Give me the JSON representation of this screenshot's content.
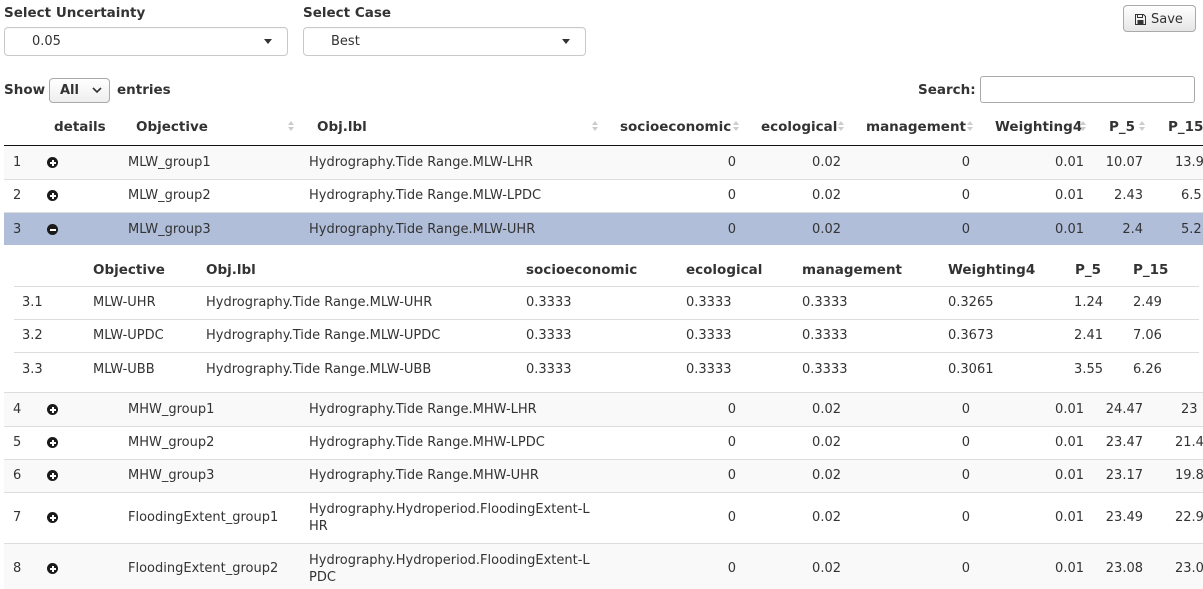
{
  "controls": {
    "uncertainty_label": "Select Uncertainty",
    "uncertainty_value": "0.05",
    "case_label": "Select Case",
    "case_value": "Best",
    "save_label": "Save",
    "show_label": "Show",
    "show_value": "All",
    "entries_label": "entries",
    "search_label": "Search:",
    "search_value": ""
  },
  "table": {
    "headers": [
      "details",
      "Objective",
      "Obj.lbl",
      "socioeconomic",
      "ecological",
      "management",
      "Weighting4",
      "P_5",
      "P_15"
    ],
    "rows": [
      {
        "idx": "1",
        "objective": "MLW_group1",
        "lbl": "Hydrography.Tide Range.MLW-LHR",
        "socio": "0",
        "eco": "0.02",
        "mgmt": "0",
        "w4": "0.01",
        "p5": "10.07",
        "p15": "13.9"
      },
      {
        "idx": "2",
        "objective": "MLW_group2",
        "lbl": "Hydrography.Tide Range.MLW-LPDC",
        "socio": "0",
        "eco": "0.02",
        "mgmt": "0",
        "w4": "0.01",
        "p5": "2.43",
        "p15": "6.5"
      },
      {
        "idx": "3",
        "objective": "MLW_group3",
        "lbl": "Hydrography.Tide Range.MLW-UHR",
        "socio": "0",
        "eco": "0.02",
        "mgmt": "0",
        "w4": "0.01",
        "p5": "2.4",
        "p15": "5.2"
      },
      {
        "idx": "4",
        "objective": "MHW_group1",
        "lbl": "Hydrography.Tide Range.MHW-LHR",
        "socio": "0",
        "eco": "0.02",
        "mgmt": "0",
        "w4": "0.01",
        "p5": "24.47",
        "p15": "23"
      },
      {
        "idx": "5",
        "objective": "MHW_group2",
        "lbl": "Hydrography.Tide Range.MHW-LPDC",
        "socio": "0",
        "eco": "0.02",
        "mgmt": "0",
        "w4": "0.01",
        "p5": "23.47",
        "p15": "21.4"
      },
      {
        "idx": "6",
        "objective": "MHW_group3",
        "lbl": "Hydrography.Tide Range.MHW-UHR",
        "socio": "0",
        "eco": "0.02",
        "mgmt": "0",
        "w4": "0.01",
        "p5": "23.17",
        "p15": "19.8"
      },
      {
        "idx": "7",
        "objective": "FloodingExtent_group1",
        "lbl": "Hydrography.Hydroperiod.FloodingExtent-LHR",
        "socio": "0",
        "eco": "0.02",
        "mgmt": "0",
        "w4": "0.01",
        "p5": "23.49",
        "p15": "22.9"
      },
      {
        "idx": "8",
        "objective": "FloodingExtent_group2",
        "lbl": "Hydrography.Hydroperiod.FloodingExtent-LPDC",
        "socio": "0",
        "eco": "0.02",
        "mgmt": "0",
        "w4": "0.01",
        "p5": "23.08",
        "p15": "23.0"
      }
    ],
    "selected_row_color": "#b0bed9"
  },
  "subtable": {
    "headers": [
      "Objective",
      "Obj.lbl",
      "socioeconomic",
      "ecological",
      "management",
      "Weighting4",
      "P_5",
      "P_15"
    ],
    "rows": [
      {
        "idx": "3.1",
        "objective": "MLW-UHR",
        "lbl": "Hydrography.Tide Range.MLW-UHR",
        "socio": "0.3333",
        "eco": "0.3333",
        "mgmt": "0.3333",
        "w4": "0.3265",
        "p5": "1.24",
        "p15": "2.49"
      },
      {
        "idx": "3.2",
        "objective": "MLW-UPDC",
        "lbl": "Hydrography.Tide Range.MLW-UPDC",
        "socio": "0.3333",
        "eco": "0.3333",
        "mgmt": "0.3333",
        "w4": "0.3673",
        "p5": "2.41",
        "p15": "7.06"
      },
      {
        "idx": "3.3",
        "objective": "MLW-UBB",
        "lbl": "Hydrography.Tide Range.MLW-UBB",
        "socio": "0.3333",
        "eco": "0.3333",
        "mgmt": "0.3333",
        "w4": "0.3061",
        "p5": "3.55",
        "p15": "6.26"
      }
    ]
  }
}
